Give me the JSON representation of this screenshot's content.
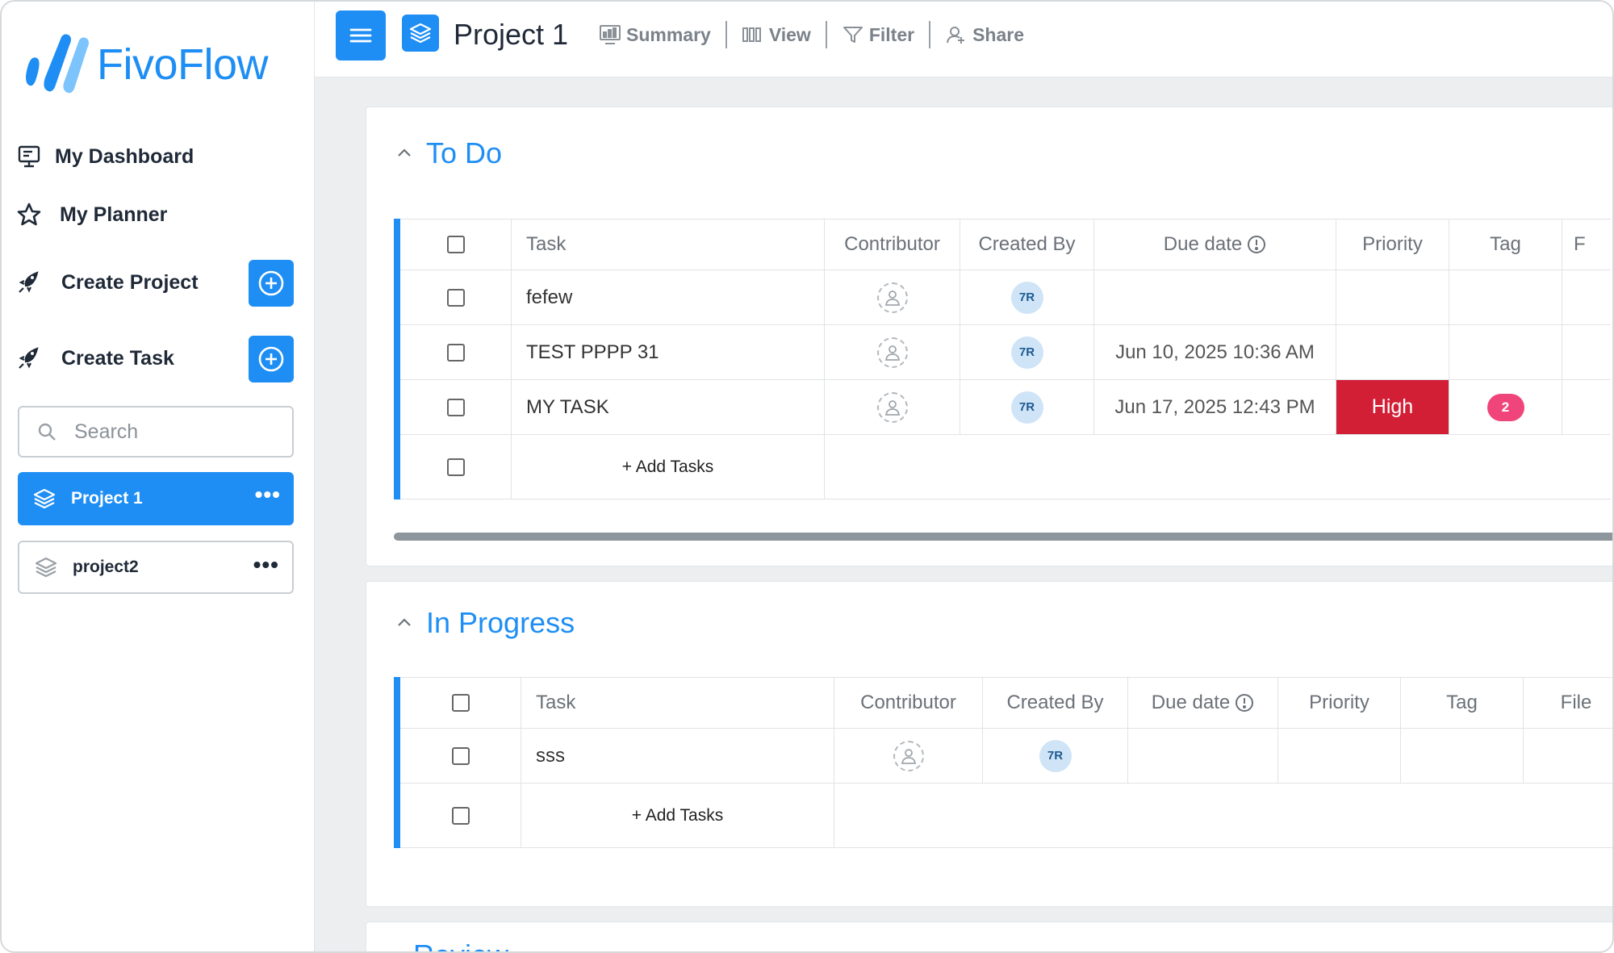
{
  "brand": {
    "name": "FivoFlow",
    "color": "#1e8ef4"
  },
  "sidebar": {
    "nav": [
      {
        "label": "My Dashboard",
        "icon": "monitor-icon"
      },
      {
        "label": "My Planner",
        "icon": "star-icon"
      },
      {
        "label": "Create Project",
        "icon": "rocket-icon"
      },
      {
        "label": "Create Task",
        "icon": "rocket-icon"
      }
    ],
    "search_placeholder": "Search",
    "projects": [
      {
        "label": "Project 1",
        "active": true
      },
      {
        "label": "project2",
        "active": false
      }
    ],
    "more_glyph": "•••"
  },
  "header": {
    "title": "Project 1",
    "tools": [
      {
        "label": "Summary",
        "icon": "summary-icon"
      },
      {
        "label": "View",
        "icon": "columns-icon"
      },
      {
        "label": "Filter",
        "icon": "filter-icon"
      },
      {
        "label": "Share",
        "icon": "share-user-icon"
      }
    ]
  },
  "groups": {
    "todo": {
      "title": "To Do",
      "columns": [
        "Task",
        "Contributor",
        "Created By",
        "Due date",
        "Priority",
        "Tag",
        "F"
      ],
      "rows": [
        {
          "task": "fefew",
          "created_by": "7R",
          "due": "",
          "priority": "",
          "tag": ""
        },
        {
          "task": "TEST PPPP 31",
          "created_by": "7R",
          "due": "Jun 10, 2025 10:36 AM",
          "priority": "",
          "tag": ""
        },
        {
          "task": "MY TASK",
          "created_by": "7R",
          "due": "Jun 17, 2025 12:43 PM",
          "priority": "High",
          "tag": "2"
        }
      ],
      "add_label": "+ Add Tasks"
    },
    "progress": {
      "title": "In Progress",
      "columns": [
        "Task",
        "Contributor",
        "Created By",
        "Due date",
        "Priority",
        "Tag",
        "File"
      ],
      "rows": [
        {
          "task": "sss",
          "created_by": "7R"
        }
      ],
      "add_label": "+ Add Tasks"
    },
    "done": {
      "title": "Review"
    }
  },
  "colors": {
    "priority_high": "#d21f36",
    "tag_pink": "#f0457b",
    "avatar_bg": "#cfe4f7"
  }
}
